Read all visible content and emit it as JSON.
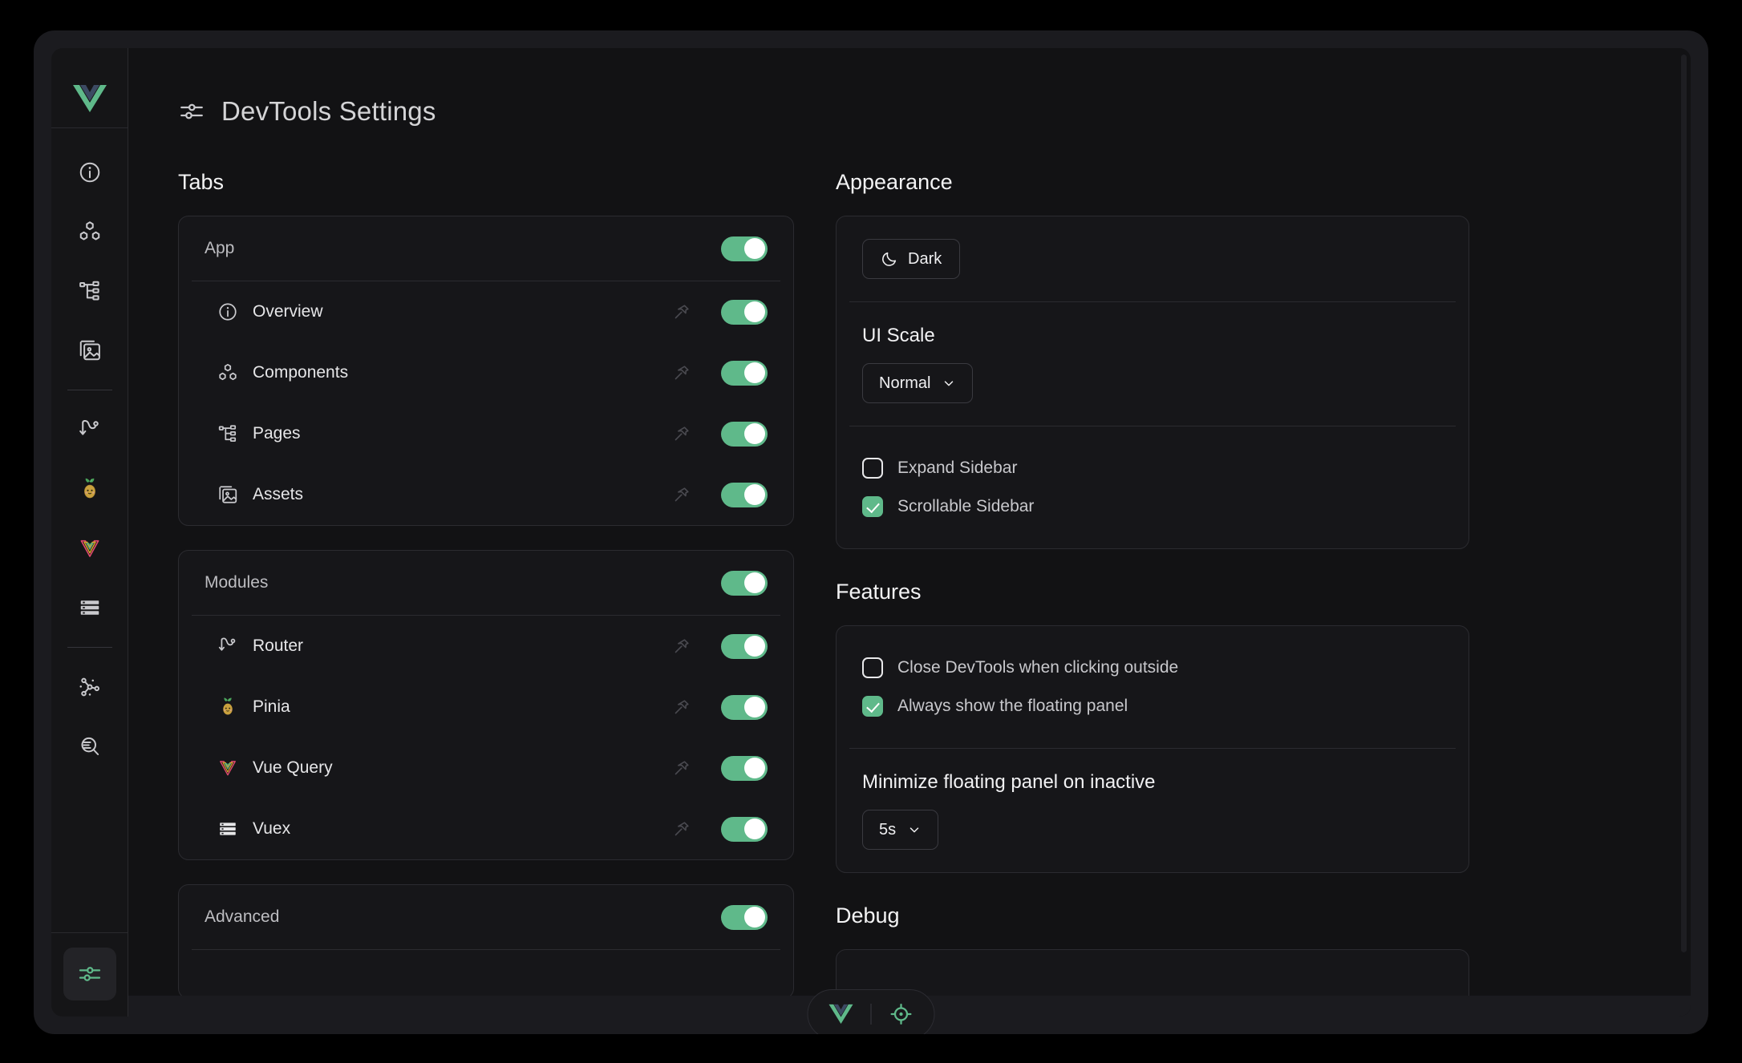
{
  "header": {
    "title": "DevTools Settings",
    "icon": "sliders-icon"
  },
  "sidebar": {
    "logo": "vue-logo-icon",
    "items": [
      {
        "name": "overview",
        "icon": "info-circle-icon"
      },
      {
        "name": "components",
        "icon": "components-icon"
      },
      {
        "name": "pages",
        "icon": "pages-tree-icon"
      },
      {
        "name": "assets",
        "icon": "assets-image-icon"
      },
      {
        "name": "router",
        "icon": "router-icon"
      },
      {
        "name": "pinia",
        "icon": "pinia-pineapple-icon"
      },
      {
        "name": "vue-query",
        "icon": "vue-query-icon"
      },
      {
        "name": "vuex",
        "icon": "vuex-list-icon"
      },
      {
        "name": "graph",
        "icon": "graph-nodes-icon"
      },
      {
        "name": "inspect",
        "icon": "search-inspect-icon"
      }
    ],
    "settings": {
      "name": "settings",
      "icon": "sliders-icon",
      "active": true
    }
  },
  "tabs": {
    "heading": "Tabs",
    "groups": [
      {
        "label": "App",
        "enabled": true,
        "items": [
          {
            "label": "Overview",
            "icon": "info-circle-icon",
            "pinned": false,
            "enabled": true
          },
          {
            "label": "Components",
            "icon": "components-icon",
            "pinned": false,
            "enabled": true
          },
          {
            "label": "Pages",
            "icon": "pages-tree-icon",
            "pinned": false,
            "enabled": true
          },
          {
            "label": "Assets",
            "icon": "assets-image-icon",
            "pinned": false,
            "enabled": true
          }
        ]
      },
      {
        "label": "Modules",
        "enabled": true,
        "items": [
          {
            "label": "Router",
            "icon": "router-icon",
            "pinned": false,
            "enabled": true
          },
          {
            "label": "Pinia",
            "icon": "pinia-pineapple-icon",
            "pinned": false,
            "enabled": true
          },
          {
            "label": "Vue Query",
            "icon": "vue-query-icon",
            "pinned": false,
            "enabled": true
          },
          {
            "label": "Vuex",
            "icon": "vuex-list-icon",
            "pinned": false,
            "enabled": true
          }
        ]
      },
      {
        "label": "Advanced",
        "enabled": true,
        "items": []
      }
    ]
  },
  "appearance": {
    "heading": "Appearance",
    "theme_button": {
      "label": "Dark",
      "icon": "moon-icon"
    },
    "ui_scale": {
      "label": "UI Scale",
      "value": "Normal",
      "options": [
        "Normal"
      ]
    },
    "checkboxes": [
      {
        "label": "Expand Sidebar",
        "checked": false
      },
      {
        "label": "Scrollable Sidebar",
        "checked": true
      }
    ]
  },
  "features": {
    "heading": "Features",
    "checkboxes": [
      {
        "label": "Close DevTools when clicking outside",
        "checked": false
      },
      {
        "label": "Always show the floating panel",
        "checked": true
      }
    ],
    "minimize": {
      "label": "Minimize floating panel on inactive",
      "value": "5s",
      "options": [
        "5s"
      ]
    }
  },
  "debug": {
    "heading": "Debug"
  },
  "floating_panel": {
    "logo": "vue-logo-icon",
    "inspect": "crosshair-inspect-icon"
  },
  "colors": {
    "accent_green": "#5fb98a",
    "panel_bg": "#161619",
    "page_bg": "#121214",
    "border": "#2b2b30"
  }
}
